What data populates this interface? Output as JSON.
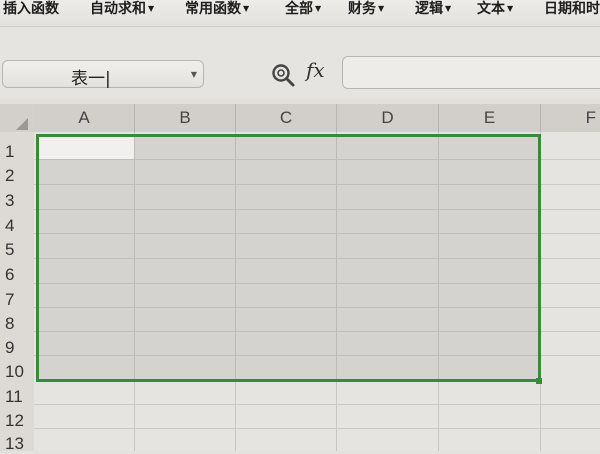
{
  "ribbon": {
    "items": [
      {
        "label": "插入函数",
        "caret": false
      },
      {
        "label": "自动求和",
        "caret": true
      },
      {
        "label": "常用函数",
        "caret": true
      },
      {
        "label": "全部",
        "caret": true
      },
      {
        "label": "财务",
        "caret": true
      },
      {
        "label": "逻辑",
        "caret": true
      },
      {
        "label": "文本",
        "caret": true
      },
      {
        "label": "日期和时",
        "caret": false
      }
    ]
  },
  "formula_bar": {
    "name_box_value": "表一|",
    "fx_label": "fx",
    "formula_value": ""
  },
  "sheet": {
    "columns": [
      "A",
      "B",
      "C",
      "D",
      "E",
      "F"
    ],
    "rows": [
      "1",
      "2",
      "3",
      "4",
      "5",
      "6",
      "7",
      "8",
      "9",
      "10",
      "11",
      "12",
      "13"
    ],
    "selection": "A1:E10",
    "accent_color": "#3a8a3a"
  },
  "icons": {
    "zoom": "magnifier-icon",
    "fx": "function-icon",
    "dropdown": "chevron-down-icon"
  }
}
